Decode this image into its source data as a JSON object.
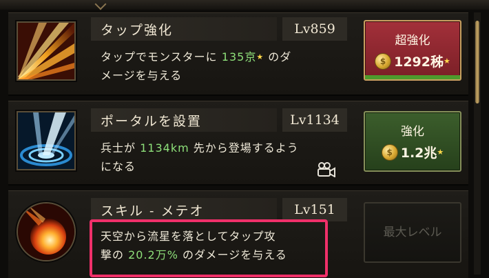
{
  "rows": [
    {
      "title": "タップ強化",
      "level": "Lv859",
      "desc_a": "タップでモンスターに ",
      "desc_value": "135京",
      "desc_b": " のダ",
      "desc_line2": "メージを与える",
      "button_label": "超強化",
      "button_cost": "1292秭",
      "button_color": "#a3303a"
    },
    {
      "title": "ポータルを設置",
      "level": "Lv1134",
      "desc_a": "兵士が ",
      "desc_value": "1134km",
      "desc_b": " 先から登場するよう",
      "desc_line2": "になる",
      "button_label": "強化",
      "button_cost": "1.2兆",
      "button_color": "#3c5e2c"
    },
    {
      "title": "スキル - メテオ",
      "level": "Lv151",
      "desc_line1": "天空から流星を落としてタップ攻",
      "desc_a": "撃の ",
      "desc_value": "20.2万%",
      "desc_b": " のダメージを与える",
      "button_label": "最大レベル"
    }
  ],
  "star_glyph": "★",
  "coin_glyph": "$",
  "icons": [
    "tap-rays-icon",
    "portal-icon",
    "meteor-icon",
    "camera-icon",
    "coin-icon"
  ],
  "highlight_color": "#f0306a"
}
